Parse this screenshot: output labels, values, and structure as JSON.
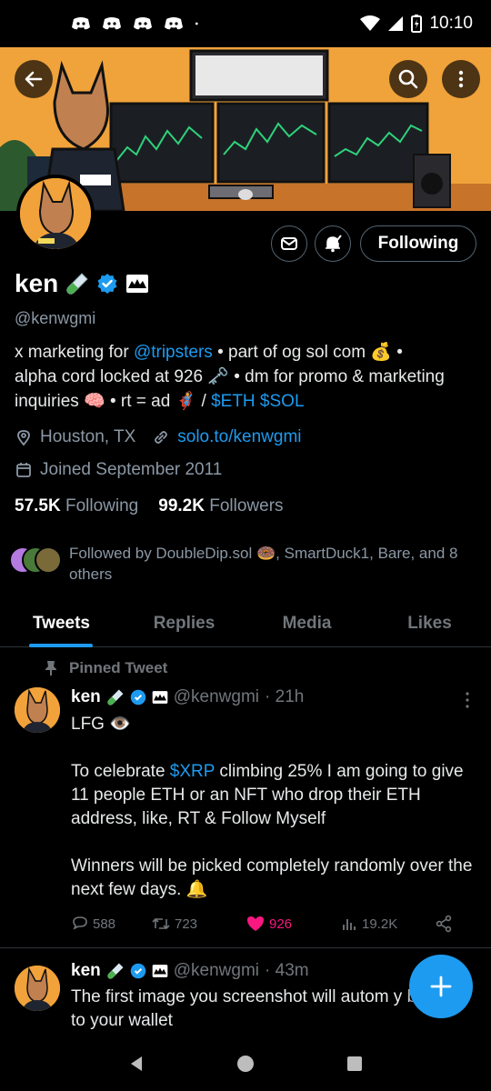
{
  "status_bar": {
    "time": "10:10"
  },
  "profile": {
    "name": "ken",
    "handle": "@kenwgmi",
    "follow_button": "Following",
    "bio": {
      "part1": "x marketing for ",
      "mention": "@tripsters",
      "part2": " • part of og sol com 💰 •",
      "line2": "alpha cord locked at 926 🗝️ • dm for promo & marketing",
      "line3a": "inquiries 🧠 • rt = ad 🦸 / ",
      "cashtags": "$ETH $SOL"
    },
    "location": "Houston, TX",
    "website": "solo.to/kenwgmi",
    "joined": "Joined September 2011",
    "following_count": "57.5K",
    "following_label": "Following",
    "followers_count": "99.2K",
    "followers_label": "Followers",
    "followed_by": "Followed by DoubleDip.sol 🍩, SmartDuck1, Bare, and 8 others"
  },
  "tabs": [
    {
      "label": "Tweets"
    },
    {
      "label": "Replies"
    },
    {
      "label": "Media"
    },
    {
      "label": "Likes"
    }
  ],
  "pinned_label": "Pinned Tweet",
  "tweets": [
    {
      "name": "ken",
      "handle": "@kenwgmi",
      "time": "· 21h",
      "line1": "LFG 👁️",
      "para2_pre": "To celebrate ",
      "para2_cashtag": "$XRP",
      "para2_post": " climbing 25% I am going to give 11 people ETH or an NFT who drop their ETH address, like, RT & Follow Myself",
      "para3": "Winners will be picked completely randomly over the next few days. 🔔",
      "replies": "588",
      "retweets": "723",
      "likes": "926",
      "views": "19.2K"
    },
    {
      "name": "ken",
      "handle": "@kenwgmi",
      "time": "· 43m",
      "text": "The first image you screenshot will autom         y be sent to your wallet"
    }
  ],
  "colors": {
    "accent": "#1d9bf0",
    "like": "#f91880",
    "banner": "#f0a33a"
  }
}
